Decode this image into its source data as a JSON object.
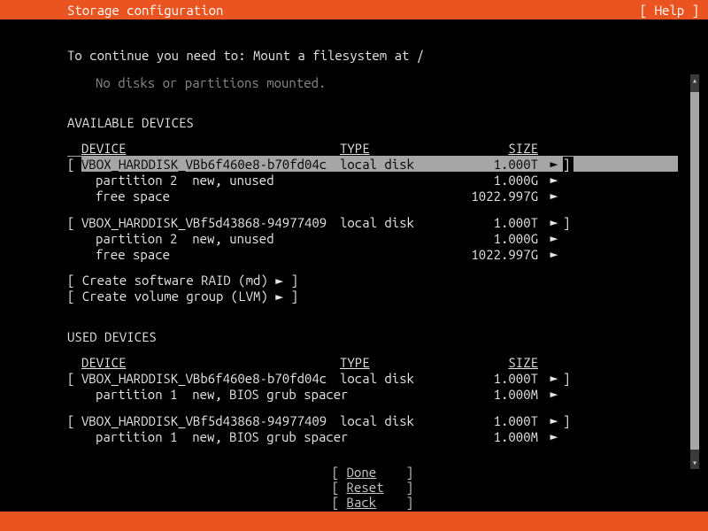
{
  "header": {
    "title": "Storage configuration",
    "help": "[ Help ]"
  },
  "instruction": "To continue you need to: Mount a filesystem at /",
  "mounted_msg": "No disks or partitions mounted.",
  "sections": {
    "available": {
      "title": "AVAILABLE DEVICES",
      "columns": {
        "device": "DEVICE",
        "type": "TYPE",
        "size": "SIZE"
      }
    },
    "used": {
      "title": "USED DEVICES",
      "columns": {
        "device": "DEVICE",
        "type": "TYPE",
        "size": "SIZE"
      }
    }
  },
  "arrow": "►",
  "lb": "[",
  "rb": "]",
  "available_devices": [
    {
      "device": "VBOX_HARDDISK_VBb6f460e8-b70fd04c",
      "type": "local disk",
      "size": "1.000T",
      "selected": true,
      "children": [
        {
          "device": "partition 2  new, unused",
          "type": "",
          "size": "1.000G"
        },
        {
          "device": "free space",
          "type": "",
          "size": "1022.997G"
        }
      ]
    },
    {
      "device": "VBOX_HARDDISK_VBf5d43868-94977409",
      "type": "local disk",
      "size": "1.000T",
      "selected": false,
      "children": [
        {
          "device": "partition 2  new, unused",
          "type": "",
          "size": "1.000G"
        },
        {
          "device": "free space",
          "type": "",
          "size": "1022.997G"
        }
      ]
    }
  ],
  "create_actions": [
    {
      "label": "Create software RAID (md)"
    },
    {
      "label": "Create volume group (LVM)"
    }
  ],
  "used_devices": [
    {
      "device": "VBOX_HARDDISK_VBb6f460e8-b70fd04c",
      "type": "local disk",
      "size": "1.000T",
      "children": [
        {
          "device": "partition 1  new, BIOS grub spacer",
          "type": "",
          "size": "1.000M"
        }
      ]
    },
    {
      "device": "VBOX_HARDDISK_VBf5d43868-94977409",
      "type": "local disk",
      "size": "1.000T",
      "children": [
        {
          "device": "partition 1  new, BIOS grub spacer",
          "type": "",
          "size": "1.000M"
        }
      ]
    }
  ],
  "buttons": {
    "done": "Done",
    "reset": "Reset",
    "back": "Back"
  }
}
